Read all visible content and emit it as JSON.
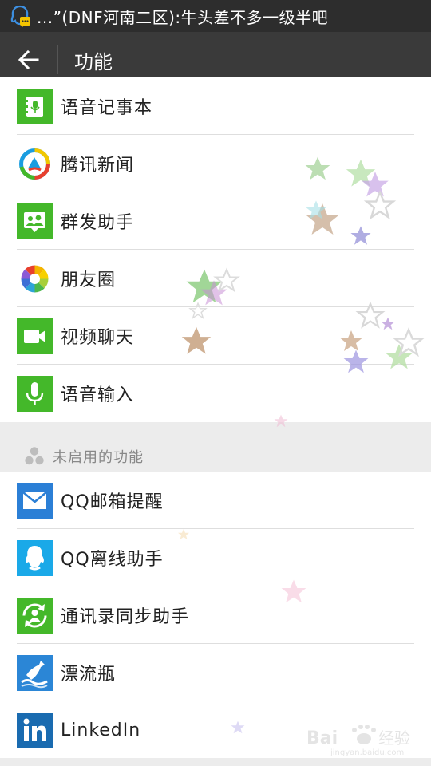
{
  "status_bar": {
    "notification_text": "...”(DNF河南二区):牛头差不多一级半吧",
    "icon": "qq-notification-icon"
  },
  "title_bar": {
    "back_icon": "back-arrow-icon",
    "title": "功能"
  },
  "enabled_features": [
    {
      "label": "语音记事本",
      "icon": "voice-notebook-icon",
      "color": "#44b82a"
    },
    {
      "label": "腾讯新闻",
      "icon": "tencent-news-icon",
      "color": "#ffffff"
    },
    {
      "label": "群发助手",
      "icon": "mass-send-icon",
      "color": "#44b82a"
    },
    {
      "label": "朋友圈",
      "icon": "moments-icon",
      "color": "#ffffff"
    },
    {
      "label": "视频聊天",
      "icon": "video-chat-icon",
      "color": "#44b82a"
    },
    {
      "label": "语音输入",
      "icon": "voice-input-icon",
      "color": "#44b82a"
    }
  ],
  "disabled_section": {
    "title": "未启用的功能",
    "icon": "disabled-features-icon"
  },
  "disabled_features": [
    {
      "label": "QQ邮箱提醒",
      "icon": "qq-mail-icon",
      "color": "#2b7fd6"
    },
    {
      "label": "QQ离线助手",
      "icon": "qq-offline-icon",
      "color": "#1aa9e8"
    },
    {
      "label": "通讯录同步助手",
      "icon": "contacts-sync-icon",
      "color": "#44b82a"
    },
    {
      "label": "漂流瓶",
      "icon": "drift-bottle-icon",
      "color": "#2b86d6"
    },
    {
      "label": "LinkedIn",
      "icon": "linkedin-icon",
      "color": "#1a6bb0"
    }
  ],
  "watermark": {
    "brand": "Bai",
    "brand_suffix": "经验",
    "url": "jingyan.baidu.com"
  }
}
